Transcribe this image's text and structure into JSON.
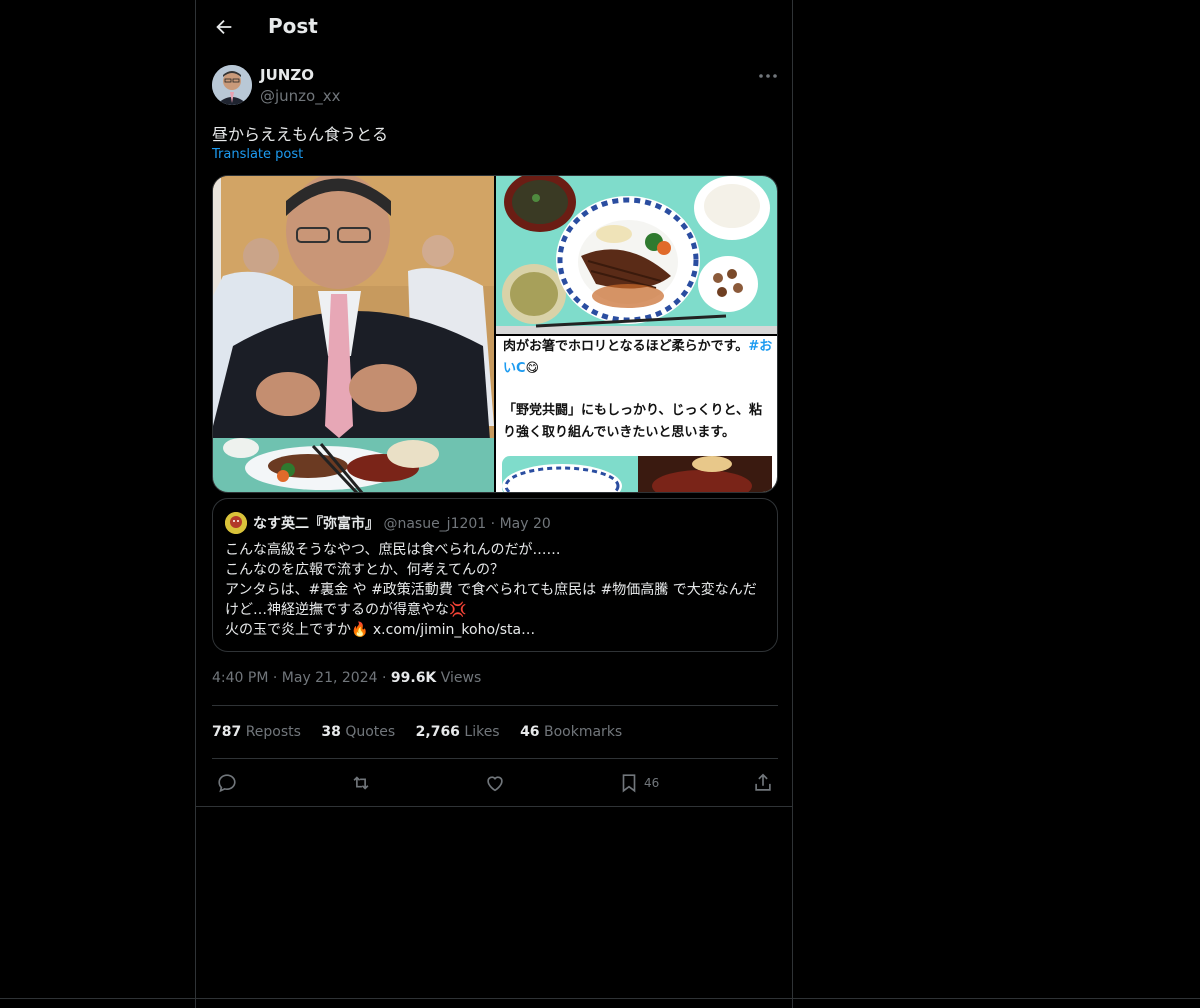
{
  "header": {
    "title": "Post"
  },
  "post": {
    "author_name": "JUNZO",
    "author_handle": "@junzo_xx",
    "text": "昼からええもん食うとる",
    "translate_label": "Translate post",
    "media_caption_line1": "肉がお箸でホロリとなるほど柔らかです。",
    "media_caption_tag": "#おいC",
    "media_caption_line2": "「野党共闘」にもしっかり、じっくりと、粘り強く取り組んでいきたいと思います。",
    "time": "4:40 PM",
    "date": "May 21, 2024",
    "views_count": "99.6K",
    "views_label": "Views"
  },
  "quote": {
    "name": "なす英二『弥富市』",
    "handle": "@nasue_j1201",
    "date": "May 20",
    "lines": [
      "こんな高級そうなやつ、庶民は食べられんのだが……",
      "こんなのを広報で流すとか、何考えてんの？",
      "アンタらは、#裏金 や #政策活動費 で食べられても庶民は #物価高騰 で大変なんだけど…神経逆撫でするのが得意やな💢",
      "火の玉で炎上ですか🔥 x.com/jimin_koho/sta…"
    ]
  },
  "stats": {
    "reposts_count": "787",
    "reposts_label": "Reposts",
    "quotes_count": "38",
    "quotes_label": "Quotes",
    "likes_count": "2,766",
    "likes_label": "Likes",
    "bookmarks_count": "46",
    "bookmarks_label": "Bookmarks"
  },
  "actions": {
    "bookmark_count": "46"
  },
  "icons": [
    "back-arrow-icon",
    "more-icon",
    "reply-icon",
    "repost-icon",
    "like-icon",
    "bookmark-icon",
    "share-icon"
  ],
  "colors": {
    "background": "#000000",
    "text": "#e7e9ea",
    "secondary": "#71767b",
    "accent": "#1d9bf0",
    "border": "#2f3336"
  }
}
